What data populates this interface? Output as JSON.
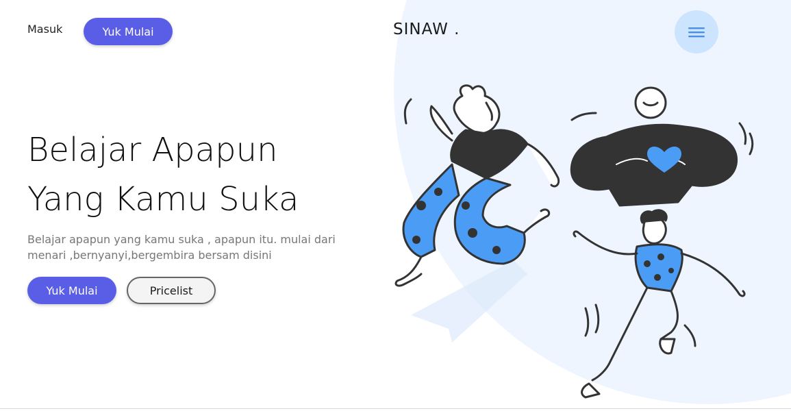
{
  "header": {
    "login_label": "Masuk",
    "cta_label": "Yuk Mulai",
    "logo_text": "SINAW .",
    "menu_icon": "hamburger-menu-icon"
  },
  "hero": {
    "title_line1": "Belajar Apapun",
    "title_line2": "Yang Kamu Suka",
    "subtitle": "Belajar apapun yang kamu suka , apapun itu. mulai dari menari ,bernyanyi,bergembira bersam disini",
    "primary_button": "Yuk Mulai",
    "secondary_button": "Pricelist"
  },
  "colors": {
    "accent": "#5a5ee6",
    "menu_circle": "#cde4ff",
    "background_blob": "#eef5ff",
    "illustration_blue": "#4a9cf5",
    "illustration_dark": "#333333"
  }
}
